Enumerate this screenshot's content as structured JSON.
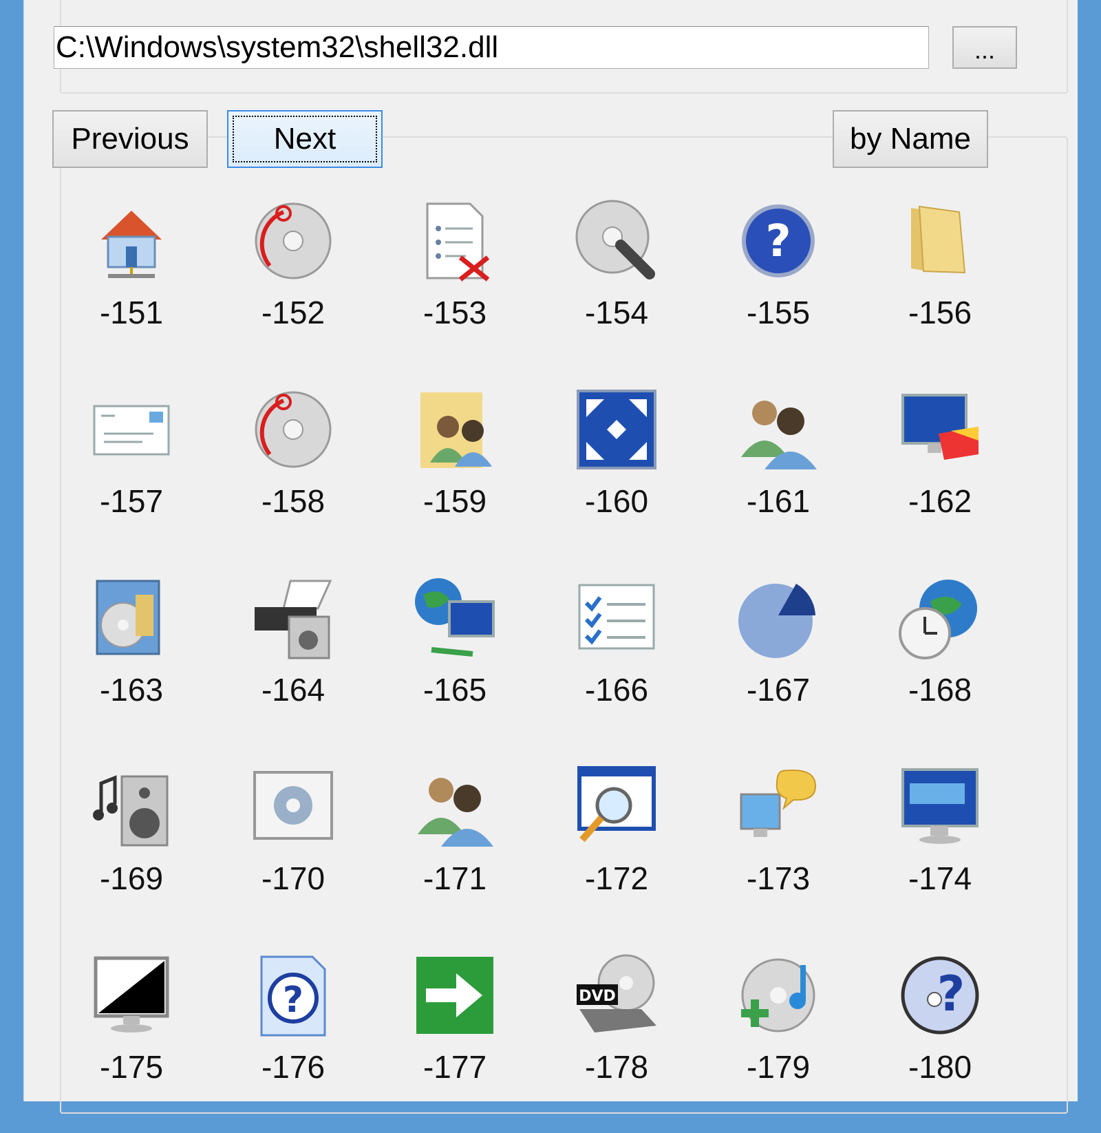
{
  "path_field": {
    "value": "C:\\Windows\\system32\\shell32.dll"
  },
  "browse_button": {
    "label": "..."
  },
  "nav": {
    "previous_label": "Previous",
    "next_label": "Next",
    "sort_label": "by Name"
  },
  "icons": [
    {
      "label": "-151",
      "icon": "home-network-icon"
    },
    {
      "label": "-152",
      "icon": "disc-burn-icon"
    },
    {
      "label": "-153",
      "icon": "document-delete-icon"
    },
    {
      "label": "-154",
      "icon": "disc-search-icon"
    },
    {
      "label": "-155",
      "icon": "help-icon"
    },
    {
      "label": "-156",
      "icon": "folder-icon"
    },
    {
      "label": "-157",
      "icon": "envelope-icon"
    },
    {
      "label": "-158",
      "icon": "disc-burn-icon"
    },
    {
      "label": "-159",
      "icon": "shared-folder-users-icon"
    },
    {
      "label": "-160",
      "icon": "fullscreen-icon"
    },
    {
      "label": "-161",
      "icon": "users-icon"
    },
    {
      "label": "-162",
      "icon": "display-color-icon"
    },
    {
      "label": "-163",
      "icon": "programs-disc-icon"
    },
    {
      "label": "-164",
      "icon": "printer-scanner-icon"
    },
    {
      "label": "-165",
      "icon": "network-globe-icon"
    },
    {
      "label": "-166",
      "icon": "checklist-icon"
    },
    {
      "label": "-167",
      "icon": "pie-chart-icon"
    },
    {
      "label": "-168",
      "icon": "globe-clock-icon"
    },
    {
      "label": "-169",
      "icon": "speaker-icon"
    },
    {
      "label": "-170",
      "icon": "settings-window-icon"
    },
    {
      "label": "-171",
      "icon": "users-icon"
    },
    {
      "label": "-172",
      "icon": "window-search-icon"
    },
    {
      "label": "-173",
      "icon": "computer-chat-icon"
    },
    {
      "label": "-174",
      "icon": "keyboard-monitor-icon"
    },
    {
      "label": "-175",
      "icon": "monitor-contrast-icon"
    },
    {
      "label": "-176",
      "icon": "help-document-icon"
    },
    {
      "label": "-177",
      "icon": "green-arrow-icon"
    },
    {
      "label": "-178",
      "icon": "dvd-drive-icon"
    },
    {
      "label": "-179",
      "icon": "add-music-disc-icon"
    },
    {
      "label": "-180",
      "icon": "disc-help-icon"
    }
  ],
  "colors": {
    "accent": "#3c8ce6",
    "window_frame": "#5b9bd5",
    "background": "#f0f0f0"
  }
}
